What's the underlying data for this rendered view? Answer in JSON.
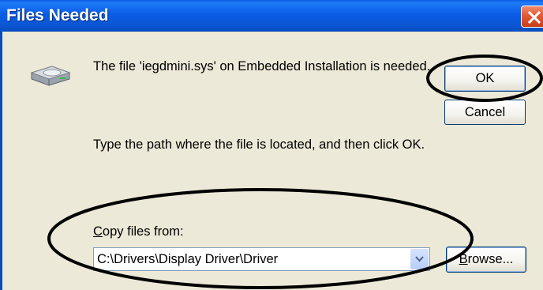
{
  "window": {
    "title": "Files Needed",
    "close_icon": "close-x-icon"
  },
  "message": {
    "line1": "The file 'iegdmini.sys' on Embedded Installation is needed.",
    "line2": "Type the path where the file is located, and then click OK."
  },
  "buttons": {
    "ok": "OK",
    "cancel": "Cancel",
    "browse_prefix": "B",
    "browse_rest": "rowse..."
  },
  "copy_from": {
    "label_prefix": "C",
    "label_rest": "opy files from:",
    "value": "C:\\Drivers\\Display Driver\\Driver"
  },
  "colors": {
    "titlebar": "#0a5ce8",
    "dialog_bg": "#ece9d8",
    "close_button": "#e35a36"
  },
  "icons": [
    "drive-icon",
    "close-x-icon",
    "chevron-down-icon"
  ]
}
